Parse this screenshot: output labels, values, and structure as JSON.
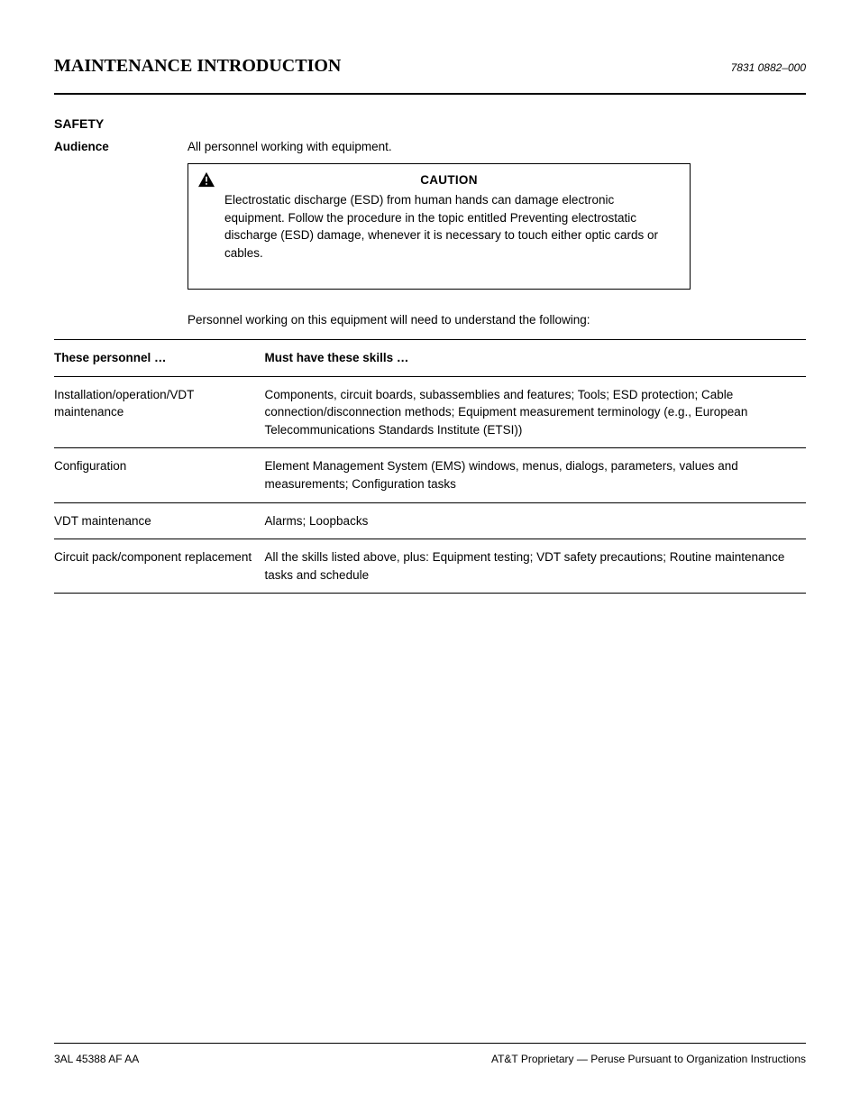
{
  "header": {
    "title": "MAINTENANCE INTRODUCTION",
    "product": "7831 0882–000"
  },
  "safety": {
    "section_label": "SAFETY",
    "audience_label": "Audience",
    "audience_value": "All personnel working with equipment.",
    "caution": {
      "title": "CAUTION",
      "body": "Electrostatic discharge (ESD) from human hands can damage electronic equipment. Follow the procedure in the topic entitled Preventing electrostatic discharge (ESD) damage, whenever it is necessary to touch either optic cards or cables."
    }
  },
  "skills": {
    "intro": "Personnel working on this equipment will need to understand the following:",
    "columns": {
      "left": "These personnel …",
      "right": "Must have these skills …"
    },
    "rows": [
      {
        "role": "Installation/operation/VDT maintenance",
        "skills": "Components, circuit boards, subassemblies and features; Tools; ESD protection; Cable connection/disconnection methods; Equipment measurement terminology (e.g., European Telecommunications Standards Institute (ETSI))"
      },
      {
        "role": "Configuration",
        "skills": "Element Management System (EMS) windows, menus, dialogs, parameters, values and measurements; Configuration tasks"
      },
      {
        "role": "VDT maintenance",
        "skills": "Alarms; Loopbacks"
      },
      {
        "role": "Circuit pack/component replacement",
        "skills": "All the skills listed above, plus: Equipment testing; VDT safety precautions; Routine maintenance tasks and schedule"
      }
    ]
  },
  "footer": {
    "left": "3AL 45388 AF AA",
    "right": "AT&T Proprietary — Peruse Pursuant to Organization Instructions"
  }
}
